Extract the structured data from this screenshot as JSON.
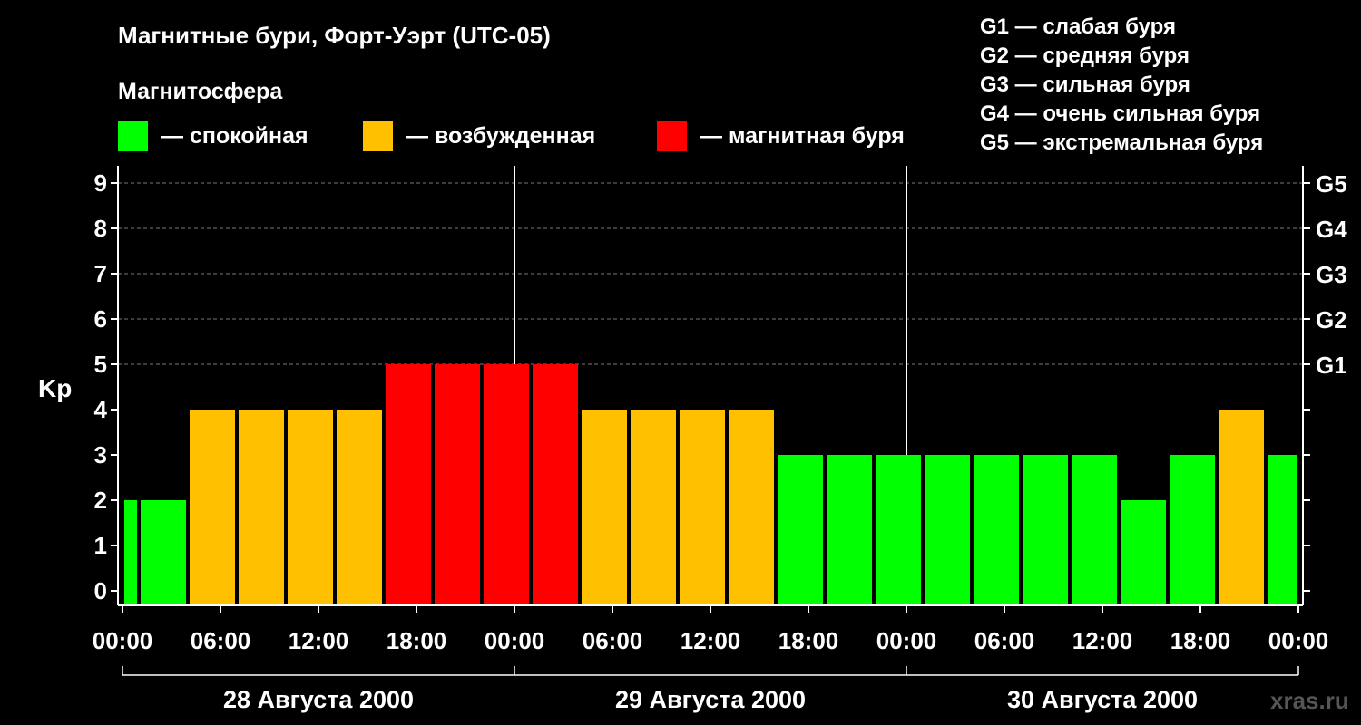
{
  "title": "Магнитные бури, Форт-Уэрт (UTC-05)",
  "legend": {
    "heading": "Магнитосфера",
    "items": [
      {
        "label": "— спокойная",
        "color": "#00ff00"
      },
      {
        "label": "— возбужденная",
        "color": "#ffc000"
      },
      {
        "label": "— магнитная буря",
        "color": "#ff0000"
      }
    ]
  },
  "g_scale": [
    "G1 — слабая буря",
    "G2 — средняя буря",
    "G3 — сильная буря",
    "G4 — очень сильная буря",
    "G5 — экстремальная буря"
  ],
  "watermark": "xras.ru",
  "chart_data": {
    "type": "bar",
    "ylabel": "Kp",
    "ylim": [
      0,
      9
    ],
    "yticks": [
      0,
      1,
      2,
      3,
      4,
      5,
      6,
      7,
      8,
      9
    ],
    "right_ticks": [
      {
        "value": 5,
        "label": "G1"
      },
      {
        "value": 6,
        "label": "G2"
      },
      {
        "value": 7,
        "label": "G3"
      },
      {
        "value": 8,
        "label": "G4"
      },
      {
        "value": 9,
        "label": "G5"
      }
    ],
    "xlim_hours": [
      0,
      72
    ],
    "xtick_labels": [
      "00:00",
      "06:00",
      "12:00",
      "18:00",
      "00:00",
      "06:00",
      "12:00",
      "18:00",
      "00:00",
      "06:00",
      "12:00",
      "18:00",
      "00:00"
    ],
    "days": [
      "28 Августа 2000",
      "29 Августа 2000",
      "30 Августа 2000"
    ],
    "grid": "dashed horizontal",
    "colors": {
      "quiet": "#00ff00",
      "unsettled": "#ffc000",
      "storm": "#ff0000"
    },
    "bars": [
      {
        "start": "28 Августа 2000 00:00",
        "end": "28 Августа 2000 01:00",
        "kp": 2
      },
      {
        "start": "28 Августа 2000 01:00",
        "end": "28 Августа 2000 04:00",
        "kp": 2
      },
      {
        "start": "28 Августа 2000 04:00",
        "end": "28 Августа 2000 07:00",
        "kp": 4
      },
      {
        "start": "28 Августа 2000 07:00",
        "end": "28 Августа 2000 10:00",
        "kp": 4
      },
      {
        "start": "28 Августа 2000 10:00",
        "end": "28 Августа 2000 13:00",
        "kp": 4
      },
      {
        "start": "28 Августа 2000 13:00",
        "end": "28 Августа 2000 16:00",
        "kp": 4
      },
      {
        "start": "28 Августа 2000 16:00",
        "end": "28 Августа 2000 19:00",
        "kp": 5
      },
      {
        "start": "28 Августа 2000 19:00",
        "end": "28 Августа 2000 22:00",
        "kp": 5
      },
      {
        "start": "28 Августа 2000 22:00",
        "end": "29 Августа 2000 01:00",
        "kp": 5
      },
      {
        "start": "29 Августа 2000 01:00",
        "end": "29 Августа 2000 04:00",
        "kp": 5
      },
      {
        "start": "29 Августа 2000 04:00",
        "end": "29 Августа 2000 07:00",
        "kp": 4
      },
      {
        "start": "29 Августа 2000 07:00",
        "end": "29 Августа 2000 10:00",
        "kp": 4
      },
      {
        "start": "29 Августа 2000 10:00",
        "end": "29 Августа 2000 13:00",
        "kp": 4
      },
      {
        "start": "29 Августа 2000 13:00",
        "end": "29 Августа 2000 16:00",
        "kp": 4
      },
      {
        "start": "29 Августа 2000 16:00",
        "end": "29 Августа 2000 19:00",
        "kp": 3
      },
      {
        "start": "29 Августа 2000 19:00",
        "end": "29 Августа 2000 22:00",
        "kp": 3
      },
      {
        "start": "29 Августа 2000 22:00",
        "end": "30 Августа 2000 01:00",
        "kp": 3
      },
      {
        "start": "30 Августа 2000 01:00",
        "end": "30 Августа 2000 04:00",
        "kp": 3
      },
      {
        "start": "30 Августа 2000 04:00",
        "end": "30 Августа 2000 07:00",
        "kp": 3
      },
      {
        "start": "30 Августа 2000 07:00",
        "end": "30 Августа 2000 10:00",
        "kp": 3
      },
      {
        "start": "30 Августа 2000 10:00",
        "end": "30 Августа 2000 13:00",
        "kp": 3
      },
      {
        "start": "30 Августа 2000 13:00",
        "end": "30 Августа 2000 16:00",
        "kp": 2
      },
      {
        "start": "30 Августа 2000 16:00",
        "end": "30 Августа 2000 19:00",
        "kp": 3
      },
      {
        "start": "30 Августа 2000 19:00",
        "end": "30 Августа 2000 22:00",
        "kp": 4
      },
      {
        "start": "30 Августа 2000 22:00",
        "end": "31 Августа 2000 00:00",
        "kp": 3
      }
    ]
  }
}
